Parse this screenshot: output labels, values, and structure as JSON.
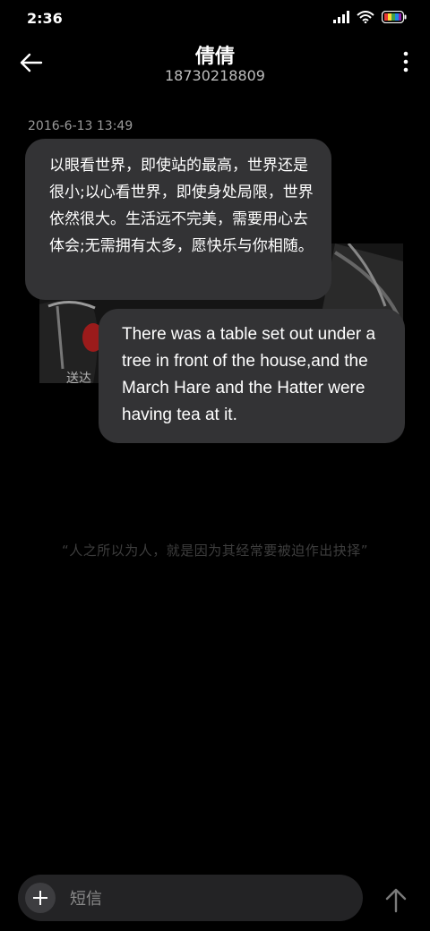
{
  "status_bar": {
    "time": "2:36",
    "icons": [
      "signal-icon",
      "wifi-icon",
      "battery-icon"
    ]
  },
  "header": {
    "contact_name": "倩倩",
    "phone_number": "18730218809",
    "back_icon": "back-arrow-icon",
    "menu_icon": "more-vertical-icon"
  },
  "conversation": {
    "timestamp": "2016-6-13 13:49",
    "messages": [
      {
        "text": "以眼看世界，即使站的最高，世界还是很小;以心看世界，即使身处局限，世界依然很大。生活远不完美，需要用心去体会;无需拥有太多，愿快乐与你相随。"
      },
      {
        "text": "There was a table set out under a tree in front of the house,and the March Hare and the Hatter were having tea at it."
      }
    ],
    "status": "送达",
    "quote": "“人之所以为人，就是因为其经常要被迫作出抉择”"
  },
  "composer": {
    "placeholder": "短信",
    "add_icon": "plus-icon",
    "send_icon": "send-arrow-icon"
  },
  "colors": {
    "background": "#000000",
    "bubble": "#333335",
    "composer": "#232325"
  }
}
